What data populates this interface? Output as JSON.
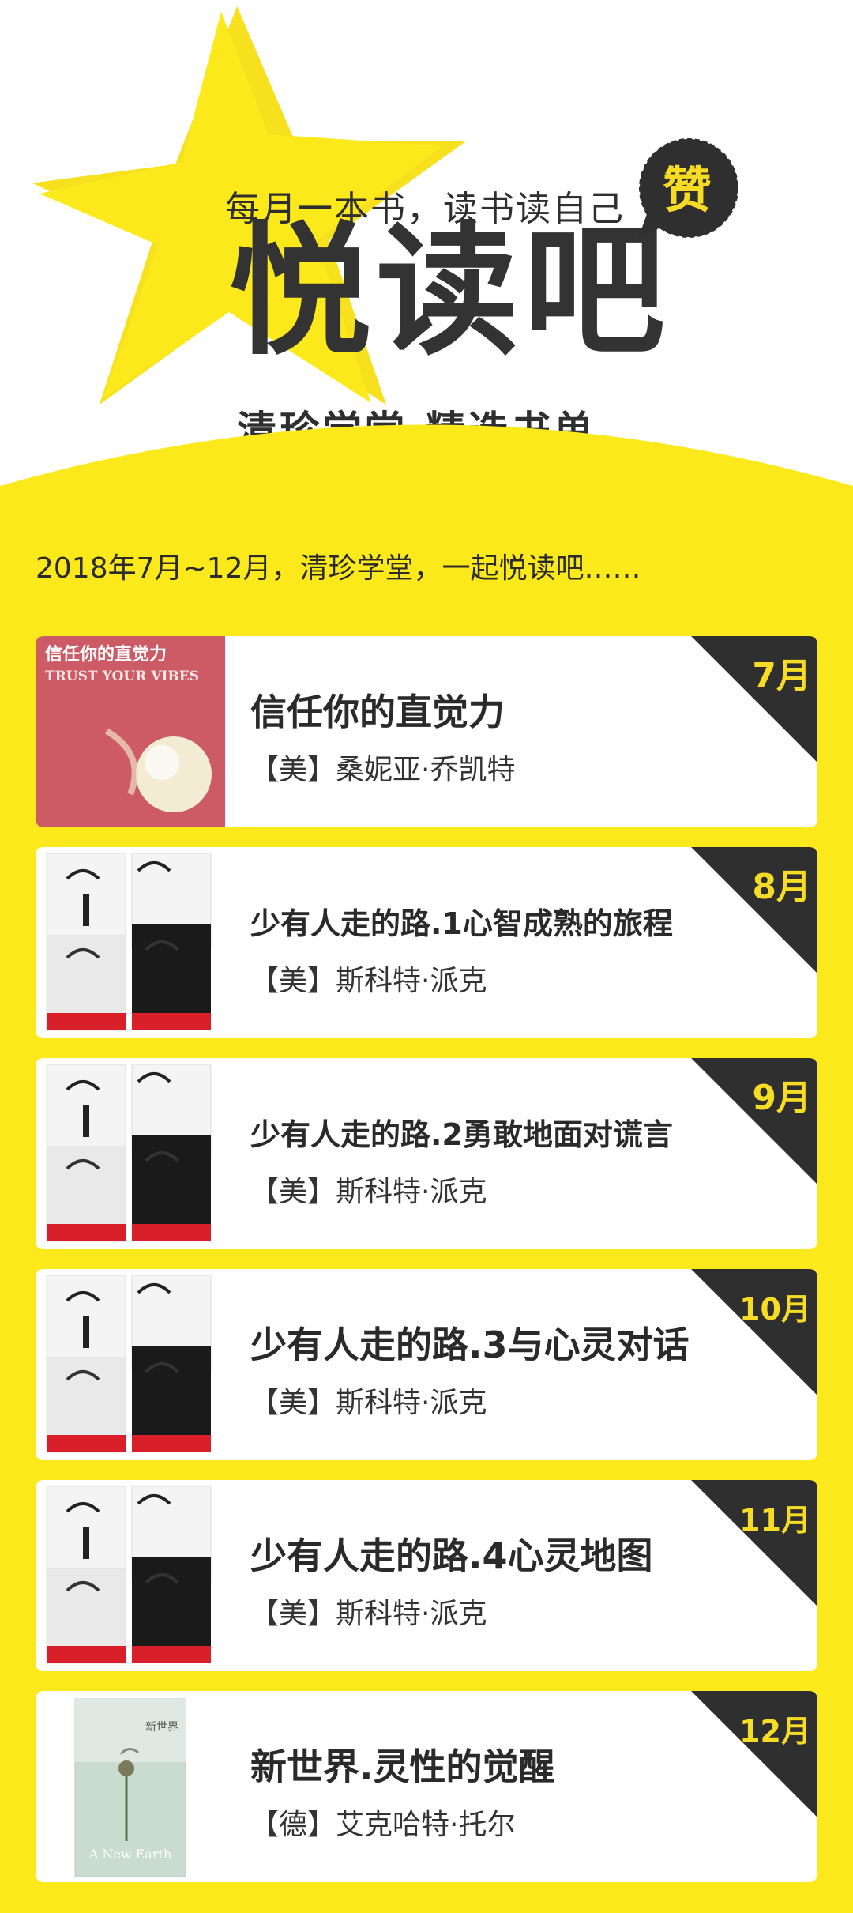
{
  "header": {
    "tagline": "每月一本书，读书读自己",
    "brand": "悦读吧",
    "badge": "赞",
    "subtitle": "清珍学堂.精选书单"
  },
  "intro": "2018年7月~12月，清珍学堂，一起悦读吧……",
  "colors": {
    "accent": "#fbe91c",
    "dark": "#2f2f2f",
    "card": "#ffffff"
  },
  "cover_texts": {
    "book1_cn": "信任你的直觉力",
    "book1_en": "TRUST YOUR VIBES",
    "book6_en": "A New Earth",
    "book6_cn": "新世界"
  },
  "books": [
    {
      "month": "7月",
      "title": "信任你的直觉力",
      "author": "【美】桑妮亚·乔凯特"
    },
    {
      "month": "8月",
      "title": "少有人走的路.1心智成熟的旅程",
      "author": "【美】斯科特·派克"
    },
    {
      "month": "9月",
      "title": "少有人走的路.2勇敢地面对谎言",
      "author": "【美】斯科特·派克"
    },
    {
      "month": "10月",
      "title": "少有人走的路.3与心灵对话",
      "author": "【美】斯科特·派克"
    },
    {
      "month": "11月",
      "title": "少有人走的路.4心灵地图",
      "author": "【美】斯科特·派克"
    },
    {
      "month": "12月",
      "title": "新世界.灵性的觉醒",
      "author": "【德】艾克哈特·托尔"
    }
  ]
}
